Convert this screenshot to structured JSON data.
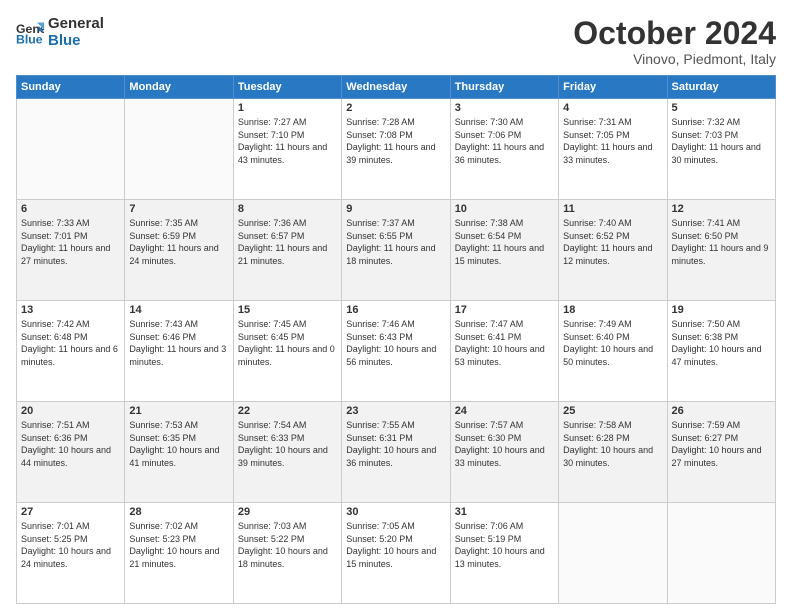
{
  "header": {
    "logo_line1": "General",
    "logo_line2": "Blue",
    "month": "October 2024",
    "location": "Vinovo, Piedmont, Italy"
  },
  "weekdays": [
    "Sunday",
    "Monday",
    "Tuesday",
    "Wednesday",
    "Thursday",
    "Friday",
    "Saturday"
  ],
  "weeks": [
    [
      {
        "day": "",
        "text": ""
      },
      {
        "day": "",
        "text": ""
      },
      {
        "day": "1",
        "text": "Sunrise: 7:27 AM\nSunset: 7:10 PM\nDaylight: 11 hours and 43 minutes."
      },
      {
        "day": "2",
        "text": "Sunrise: 7:28 AM\nSunset: 7:08 PM\nDaylight: 11 hours and 39 minutes."
      },
      {
        "day": "3",
        "text": "Sunrise: 7:30 AM\nSunset: 7:06 PM\nDaylight: 11 hours and 36 minutes."
      },
      {
        "day": "4",
        "text": "Sunrise: 7:31 AM\nSunset: 7:05 PM\nDaylight: 11 hours and 33 minutes."
      },
      {
        "day": "5",
        "text": "Sunrise: 7:32 AM\nSunset: 7:03 PM\nDaylight: 11 hours and 30 minutes."
      }
    ],
    [
      {
        "day": "6",
        "text": "Sunrise: 7:33 AM\nSunset: 7:01 PM\nDaylight: 11 hours and 27 minutes."
      },
      {
        "day": "7",
        "text": "Sunrise: 7:35 AM\nSunset: 6:59 PM\nDaylight: 11 hours and 24 minutes."
      },
      {
        "day": "8",
        "text": "Sunrise: 7:36 AM\nSunset: 6:57 PM\nDaylight: 11 hours and 21 minutes."
      },
      {
        "day": "9",
        "text": "Sunrise: 7:37 AM\nSunset: 6:55 PM\nDaylight: 11 hours and 18 minutes."
      },
      {
        "day": "10",
        "text": "Sunrise: 7:38 AM\nSunset: 6:54 PM\nDaylight: 11 hours and 15 minutes."
      },
      {
        "day": "11",
        "text": "Sunrise: 7:40 AM\nSunset: 6:52 PM\nDaylight: 11 hours and 12 minutes."
      },
      {
        "day": "12",
        "text": "Sunrise: 7:41 AM\nSunset: 6:50 PM\nDaylight: 11 hours and 9 minutes."
      }
    ],
    [
      {
        "day": "13",
        "text": "Sunrise: 7:42 AM\nSunset: 6:48 PM\nDaylight: 11 hours and 6 minutes."
      },
      {
        "day": "14",
        "text": "Sunrise: 7:43 AM\nSunset: 6:46 PM\nDaylight: 11 hours and 3 minutes."
      },
      {
        "day": "15",
        "text": "Sunrise: 7:45 AM\nSunset: 6:45 PM\nDaylight: 11 hours and 0 minutes."
      },
      {
        "day": "16",
        "text": "Sunrise: 7:46 AM\nSunset: 6:43 PM\nDaylight: 10 hours and 56 minutes."
      },
      {
        "day": "17",
        "text": "Sunrise: 7:47 AM\nSunset: 6:41 PM\nDaylight: 10 hours and 53 minutes."
      },
      {
        "day": "18",
        "text": "Sunrise: 7:49 AM\nSunset: 6:40 PM\nDaylight: 10 hours and 50 minutes."
      },
      {
        "day": "19",
        "text": "Sunrise: 7:50 AM\nSunset: 6:38 PM\nDaylight: 10 hours and 47 minutes."
      }
    ],
    [
      {
        "day": "20",
        "text": "Sunrise: 7:51 AM\nSunset: 6:36 PM\nDaylight: 10 hours and 44 minutes."
      },
      {
        "day": "21",
        "text": "Sunrise: 7:53 AM\nSunset: 6:35 PM\nDaylight: 10 hours and 41 minutes."
      },
      {
        "day": "22",
        "text": "Sunrise: 7:54 AM\nSunset: 6:33 PM\nDaylight: 10 hours and 39 minutes."
      },
      {
        "day": "23",
        "text": "Sunrise: 7:55 AM\nSunset: 6:31 PM\nDaylight: 10 hours and 36 minutes."
      },
      {
        "day": "24",
        "text": "Sunrise: 7:57 AM\nSunset: 6:30 PM\nDaylight: 10 hours and 33 minutes."
      },
      {
        "day": "25",
        "text": "Sunrise: 7:58 AM\nSunset: 6:28 PM\nDaylight: 10 hours and 30 minutes."
      },
      {
        "day": "26",
        "text": "Sunrise: 7:59 AM\nSunset: 6:27 PM\nDaylight: 10 hours and 27 minutes."
      }
    ],
    [
      {
        "day": "27",
        "text": "Sunrise: 7:01 AM\nSunset: 5:25 PM\nDaylight: 10 hours and 24 minutes."
      },
      {
        "day": "28",
        "text": "Sunrise: 7:02 AM\nSunset: 5:23 PM\nDaylight: 10 hours and 21 minutes."
      },
      {
        "day": "29",
        "text": "Sunrise: 7:03 AM\nSunset: 5:22 PM\nDaylight: 10 hours and 18 minutes."
      },
      {
        "day": "30",
        "text": "Sunrise: 7:05 AM\nSunset: 5:20 PM\nDaylight: 10 hours and 15 minutes."
      },
      {
        "day": "31",
        "text": "Sunrise: 7:06 AM\nSunset: 5:19 PM\nDaylight: 10 hours and 13 minutes."
      },
      {
        "day": "",
        "text": ""
      },
      {
        "day": "",
        "text": ""
      }
    ]
  ]
}
